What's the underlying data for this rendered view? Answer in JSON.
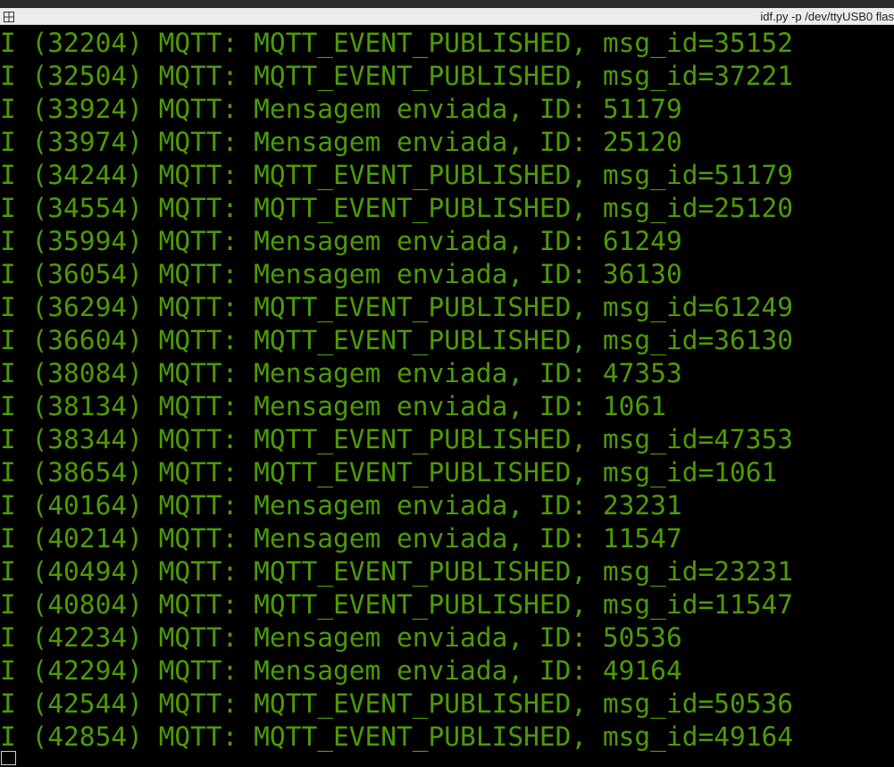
{
  "window": {
    "title": "idf.py -p /dev/ttyUSB0 flas",
    "split_icon": "split-terminal-icon"
  },
  "colors": {
    "background": "#000000",
    "log_text": "#4e9a06",
    "title_bar": "#ececec"
  },
  "terminal": {
    "lines": [
      "I (32204) MQTT: MQTT_EVENT_PUBLISHED, msg_id=35152",
      "I (32504) MQTT: MQTT_EVENT_PUBLISHED, msg_id=37221",
      "I (33924) MQTT: Mensagem enviada, ID: 51179",
      "I (33974) MQTT: Mensagem enviada, ID: 25120",
      "I (34244) MQTT: MQTT_EVENT_PUBLISHED, msg_id=51179",
      "I (34554) MQTT: MQTT_EVENT_PUBLISHED, msg_id=25120",
      "I (35994) MQTT: Mensagem enviada, ID: 61249",
      "I (36054) MQTT: Mensagem enviada, ID: 36130",
      "I (36294) MQTT: MQTT_EVENT_PUBLISHED, msg_id=61249",
      "I (36604) MQTT: MQTT_EVENT_PUBLISHED, msg_id=36130",
      "I (38084) MQTT: Mensagem enviada, ID: 47353",
      "I (38134) MQTT: Mensagem enviada, ID: 1061",
      "I (38344) MQTT: MQTT_EVENT_PUBLISHED, msg_id=47353",
      "I (38654) MQTT: MQTT_EVENT_PUBLISHED, msg_id=1061",
      "I (40164) MQTT: Mensagem enviada, ID: 23231",
      "I (40214) MQTT: Mensagem enviada, ID: 11547",
      "I (40494) MQTT: MQTT_EVENT_PUBLISHED, msg_id=23231",
      "I (40804) MQTT: MQTT_EVENT_PUBLISHED, msg_id=11547",
      "I (42234) MQTT: Mensagem enviada, ID: 50536",
      "I (42294) MQTT: Mensagem enviada, ID: 49164",
      "I (42544) MQTT: MQTT_EVENT_PUBLISHED, msg_id=50536",
      "I (42854) MQTT: MQTT_EVENT_PUBLISHED, msg_id=49164"
    ]
  }
}
